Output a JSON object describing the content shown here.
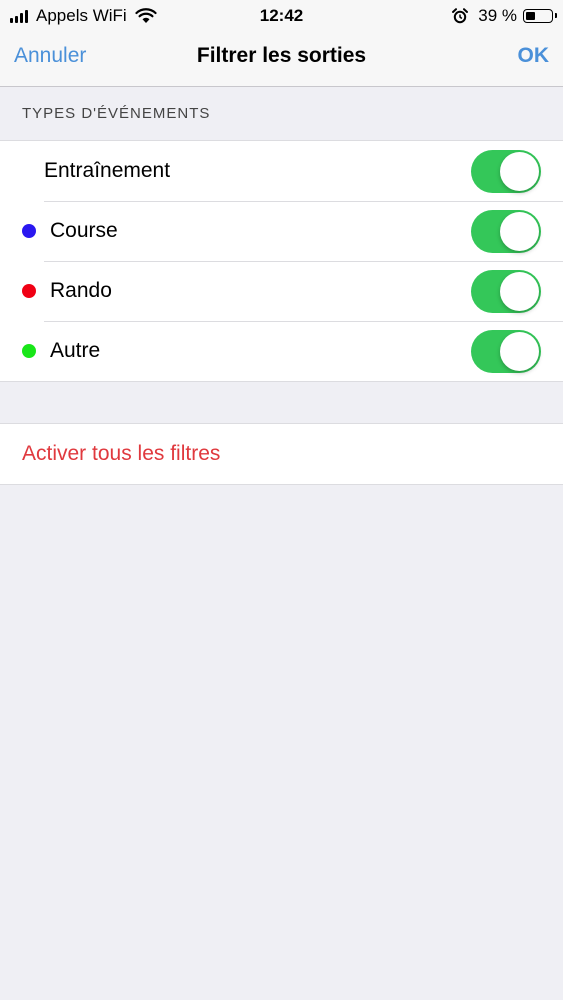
{
  "status_bar": {
    "carrier": "Appels WiFi",
    "time": "12:42",
    "battery_text": "39 %",
    "battery_level": 0.39,
    "icons": [
      "signal-icon",
      "wifi-icon",
      "alarm-icon",
      "battery-icon"
    ]
  },
  "nav": {
    "cancel_label": "Annuler",
    "title": "Filtrer les sorties",
    "ok_label": "OK",
    "accent_color": "#4a90d9"
  },
  "section": {
    "header": "TYPES D'ÉVÉNEMENTS"
  },
  "types": [
    {
      "label": "Entraînement",
      "enabled": true
    },
    {
      "label": "Course",
      "dot_color": "#2a17f0",
      "enabled": true
    },
    {
      "label": "Rando",
      "dot_color": "#f00014",
      "enabled": true
    },
    {
      "label": "Autre",
      "dot_color": "#19e619",
      "enabled": true
    }
  ],
  "actions": {
    "enable_all_label": "Activer tous les filtres",
    "enable_all_color": "#e0393e"
  },
  "toggle_on_color": "#34c759"
}
